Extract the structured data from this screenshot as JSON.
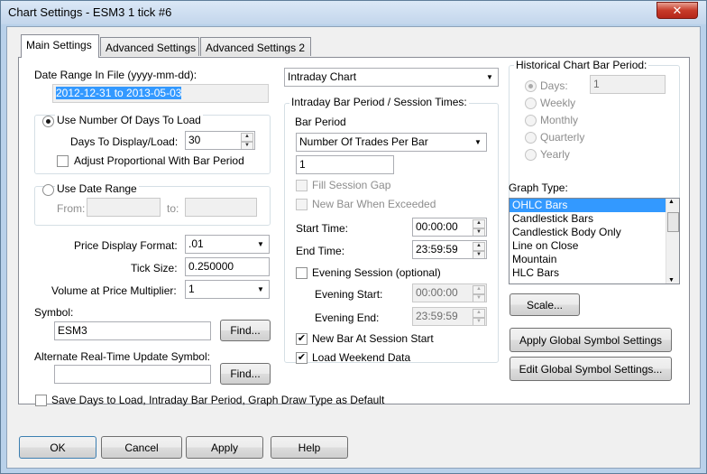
{
  "window": {
    "title": "Chart Settings - ESM3  1 tick  #6",
    "close_glyph": "✕"
  },
  "tabs": [
    {
      "label": "Main Settings",
      "active": true
    },
    {
      "label": "Advanced Settings",
      "active": false
    },
    {
      "label": "Advanced Settings 2",
      "active": false
    }
  ],
  "date_range": {
    "label": "Date Range In File (yyyy-mm-dd):",
    "value": "2012-12-31 to 2013-05-03"
  },
  "days_group": {
    "radio_label": "Use Number Of Days To Load",
    "days_label": "Days To Display/Load:",
    "days_value": "30",
    "adjust_label": "Adjust Proportional With Bar Period"
  },
  "date_range_group": {
    "radio_label": "Use Date Range",
    "from_label": "From:",
    "to_label": "to:"
  },
  "price_display": {
    "label": "Price Display Format:",
    "value": ".01"
  },
  "tick_size": {
    "label": "Tick Size:",
    "value": "0.250000"
  },
  "volume_multiplier": {
    "label": "Volume at Price Multiplier:",
    "value": "1"
  },
  "symbol": {
    "label": "Symbol:",
    "value": "ESM3",
    "find": "Find..."
  },
  "alt_symbol": {
    "label": "Alternate Real-Time Update Symbol:",
    "value": "",
    "find": "Find..."
  },
  "save_default": {
    "label": "Save Days to Load, Intraday Bar Period, Graph Draw Type as Default",
    "checked": false
  },
  "chart_type": {
    "value": "Intraday Chart"
  },
  "intraday": {
    "legend": "Intraday Bar Period / Session Times:",
    "bar_period_label": "Bar Period",
    "bar_period_value": "Number Of Trades Per Bar",
    "bar_period_amount": "1",
    "fill_session_gap": "Fill Session Gap",
    "new_bar_exceeded": "New Bar When Exceeded",
    "start_time_label": "Start Time:",
    "start_time": "00:00:00",
    "end_time_label": "End Time:",
    "end_time": "23:59:59",
    "evening_session": "Evening Session (optional)",
    "evening_start_label": "Evening Start:",
    "evening_start": "00:00:00",
    "evening_end_label": "Evening End:",
    "evening_end": "23:59:59",
    "new_bar_session_start": "New Bar At Session Start",
    "load_weekend": "Load Weekend Data"
  },
  "historical": {
    "legend": "Historical Chart Bar Period:",
    "options": [
      "Days:",
      "Weekly",
      "Monthly",
      "Quarterly",
      "Yearly"
    ],
    "days_value": "1"
  },
  "graph_type": {
    "label": "Graph Type:",
    "items": [
      "OHLC Bars",
      "Candlestick Bars",
      "Candlestick Body Only",
      "Line on Close",
      "Mountain",
      "HLC Bars"
    ],
    "selected": "OHLC Bars"
  },
  "buttons": {
    "scale": "Scale...",
    "apply_global": "Apply Global Symbol Settings",
    "edit_global": "Edit Global Symbol Settings...",
    "ok": "OK",
    "cancel": "Cancel",
    "apply": "Apply",
    "help": "Help"
  },
  "glyphs": {
    "check": "✔",
    "dropdown": "▼",
    "up": "▲",
    "down": "▼"
  }
}
